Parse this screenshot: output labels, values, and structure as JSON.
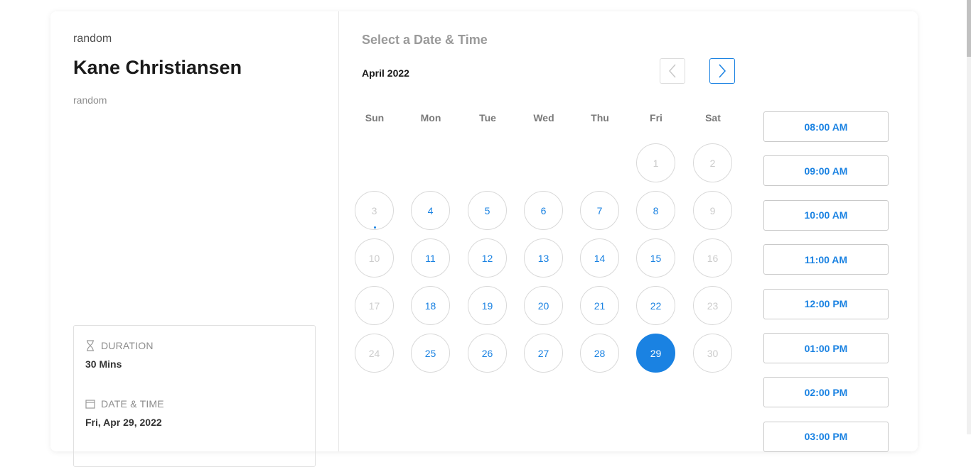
{
  "event": {
    "organizer": "random",
    "host_name": "Kane Christiansen",
    "description": "random",
    "duration_label": "DURATION",
    "duration_value": "30 Mins",
    "datetime_label": "DATE & TIME",
    "datetime_value": "Fri, Apr 29, 2022"
  },
  "calendar": {
    "title": "Select a Date & Time",
    "month_label": "April 2022",
    "weekdays": [
      "Sun",
      "Mon",
      "Tue",
      "Wed",
      "Thu",
      "Fri",
      "Sat"
    ],
    "days": [
      {
        "n": "1",
        "state": "disabled",
        "col": 5,
        "row": 0
      },
      {
        "n": "2",
        "state": "disabled",
        "col": 6,
        "row": 0
      },
      {
        "n": "3",
        "state": "disabled",
        "col": 0,
        "row": 1,
        "today": true
      },
      {
        "n": "4",
        "state": "available",
        "col": 1,
        "row": 1
      },
      {
        "n": "5",
        "state": "available",
        "col": 2,
        "row": 1
      },
      {
        "n": "6",
        "state": "available",
        "col": 3,
        "row": 1
      },
      {
        "n": "7",
        "state": "available",
        "col": 4,
        "row": 1
      },
      {
        "n": "8",
        "state": "available",
        "col": 5,
        "row": 1
      },
      {
        "n": "9",
        "state": "disabled",
        "col": 6,
        "row": 1
      },
      {
        "n": "10",
        "state": "disabled",
        "col": 0,
        "row": 2
      },
      {
        "n": "11",
        "state": "available",
        "col": 1,
        "row": 2
      },
      {
        "n": "12",
        "state": "available",
        "col": 2,
        "row": 2
      },
      {
        "n": "13",
        "state": "available",
        "col": 3,
        "row": 2
      },
      {
        "n": "14",
        "state": "available",
        "col": 4,
        "row": 2
      },
      {
        "n": "15",
        "state": "available",
        "col": 5,
        "row": 2
      },
      {
        "n": "16",
        "state": "disabled",
        "col": 6,
        "row": 2
      },
      {
        "n": "17",
        "state": "disabled",
        "col": 0,
        "row": 3
      },
      {
        "n": "18",
        "state": "available",
        "col": 1,
        "row": 3
      },
      {
        "n": "19",
        "state": "available",
        "col": 2,
        "row": 3
      },
      {
        "n": "20",
        "state": "available",
        "col": 3,
        "row": 3
      },
      {
        "n": "21",
        "state": "available",
        "col": 4,
        "row": 3
      },
      {
        "n": "22",
        "state": "available",
        "col": 5,
        "row": 3
      },
      {
        "n": "23",
        "state": "disabled",
        "col": 6,
        "row": 3
      },
      {
        "n": "24",
        "state": "disabled",
        "col": 0,
        "row": 4
      },
      {
        "n": "25",
        "state": "available",
        "col": 1,
        "row": 4
      },
      {
        "n": "26",
        "state": "available",
        "col": 2,
        "row": 4
      },
      {
        "n": "27",
        "state": "available",
        "col": 3,
        "row": 4
      },
      {
        "n": "28",
        "state": "available",
        "col": 4,
        "row": 4
      },
      {
        "n": "29",
        "state": "selected",
        "col": 5,
        "row": 4
      },
      {
        "n": "30",
        "state": "disabled",
        "col": 6,
        "row": 4
      }
    ]
  },
  "time_slots": [
    "08:00 AM",
    "09:00 AM",
    "10:00 AM",
    "11:00 AM",
    "12:00 PM",
    "01:00 PM",
    "02:00 PM",
    "03:00 PM"
  ],
  "colors": {
    "accent": "#1a82e2",
    "disabled_text": "#cccccc"
  },
  "icons": {
    "prev": "chevron-left-icon",
    "next": "chevron-right-icon",
    "duration": "hourglass-icon",
    "datetime": "calendar-icon"
  }
}
